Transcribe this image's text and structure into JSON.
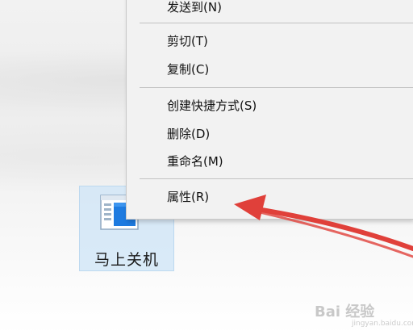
{
  "desktop": {
    "shortcut": {
      "label": "马上关机",
      "icon": "window-app-icon",
      "selected": true
    }
  },
  "context_menu": {
    "items": [
      {
        "label": "发送到(N)"
      },
      {
        "label": "剪切(T)"
      },
      {
        "label": "复制(C)"
      },
      {
        "label": "创建快捷方式(S)"
      },
      {
        "label": "删除(D)"
      },
      {
        "label": "重命名(M)"
      },
      {
        "label": "属性(R)"
      }
    ]
  },
  "annotation": {
    "arrow_color": "#e0403a",
    "points_to": "属性(R)"
  },
  "watermark": {
    "text": "Bai 经验",
    "subtext": "jingyan.baidu.com"
  },
  "colors": {
    "menu_background": "#f2f2f2",
    "selection_highlight": "#cde4f7",
    "separator": "#c2c2c2"
  }
}
